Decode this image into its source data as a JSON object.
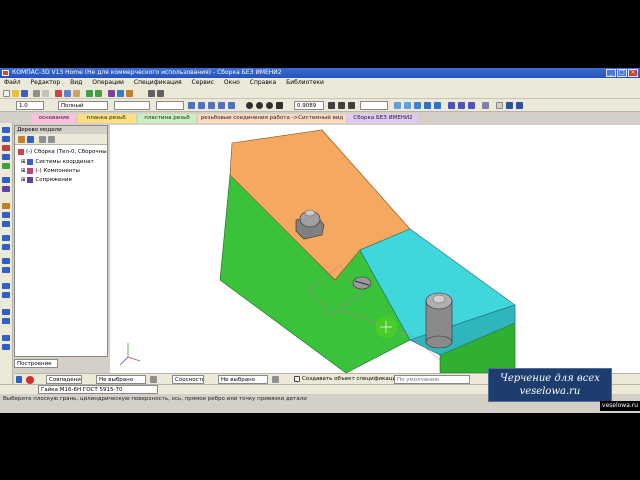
{
  "window": {
    "title": "КОМПАС-3D V13 Home (Не для коммерческого использования) - Сборка БЕЗ ИМЕНИ2",
    "buttons": [
      "_",
      "□",
      "×"
    ]
  },
  "menu": [
    "Файл",
    "Редактор",
    "Вид",
    "Операции",
    "Спецификация",
    "Сервис",
    "Окно",
    "Справка",
    "Библиотеки"
  ],
  "toolbar": {
    "zoom_value": "0.9089",
    "scale_value": "1.0",
    "view_style": "Полный"
  },
  "tabs": [
    {
      "label": "основание",
      "color": "#ffc0e0"
    },
    {
      "label": "планка резьб.",
      "color": "#ffe080"
    },
    {
      "label": "пластина резьб",
      "color": "#c8f0c0"
    },
    {
      "label": "резьбовые соединения работа ->Системный вид",
      "color": "#ffd8c0"
    },
    {
      "label": "Сборка БЕЗ ИМЕНИ2",
      "color": "#e0c8f8"
    }
  ],
  "tree": {
    "header": "Дерево модели",
    "items": [
      {
        "label": "(-) Сборка (Тел-0, Сборочны",
        "indent": 0
      },
      {
        "label": "Системы координат",
        "indent": 1
      },
      {
        "label": "(-) Компоненты",
        "indent": 1
      },
      {
        "label": "Сопряжения",
        "indent": 1
      }
    ],
    "bottom_tab": "Построение"
  },
  "bottom": {
    "label1": "Совпадение",
    "value1": "Не выбрано",
    "label2": "Соосность",
    "value2": "Не выбрано",
    "checkbox_label": "Создавать объект спецификации",
    "dropdown": "По умолчанию"
  },
  "status": {
    "object": "Гайка М16-6Н ГОСТ 5915-70"
  },
  "prompt": "Выберите плоскую грань, цилиндрическую поверхность, ось, прямое ребро или точку привязки детали",
  "watermark": {
    "line1": "Черчение для всех",
    "line2": "veselowa.ru",
    "corner": "veselowa.ru"
  },
  "colors": {
    "orange_part": "#f4a860",
    "green_part": "#3cc43c",
    "cyan_part": "#40d8dc",
    "cursor": "#4ccc28"
  }
}
